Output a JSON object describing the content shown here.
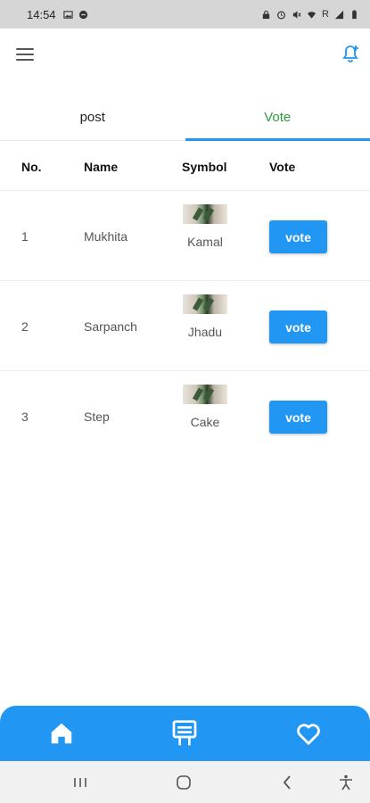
{
  "status_bar": {
    "time": "14:54",
    "left_icons": [
      "image-icon",
      "circle-icon"
    ],
    "right_text": "R",
    "right_icons": [
      "lock-icon",
      "alarm-icon",
      "mute-icon",
      "wifi-icon",
      "signal-icon",
      "battery-icon"
    ]
  },
  "app_bar": {
    "menu_icon": "menu-icon",
    "bell_icon": "add-alert-icon"
  },
  "tabs": [
    {
      "label": "post",
      "selected": false
    },
    {
      "label": "Vote",
      "selected": true
    }
  ],
  "table": {
    "headers": [
      "No.",
      "Name",
      "Symbol",
      "Vote"
    ],
    "rows": [
      {
        "no": "1",
        "name": "Mukhita",
        "symbol": "Kamal",
        "vote_label": "vote"
      },
      {
        "no": "2",
        "name": "Sarpanch",
        "symbol": "Jhadu",
        "vote_label": "vote"
      },
      {
        "no": "3",
        "name": "Step",
        "symbol": "Cake",
        "vote_label": "vote"
      }
    ]
  },
  "bottom_nav": {
    "items": [
      "home-icon",
      "ballot-icon",
      "heart-icon"
    ]
  },
  "system_nav": {
    "items": [
      "recent-apps-icon",
      "home-circle-icon",
      "back-icon",
      "accessibility-icon"
    ]
  },
  "colors": {
    "accent": "#2196F3",
    "tab_selected_text": "#2e9c3b",
    "status_bar": "#d6d6d6"
  }
}
